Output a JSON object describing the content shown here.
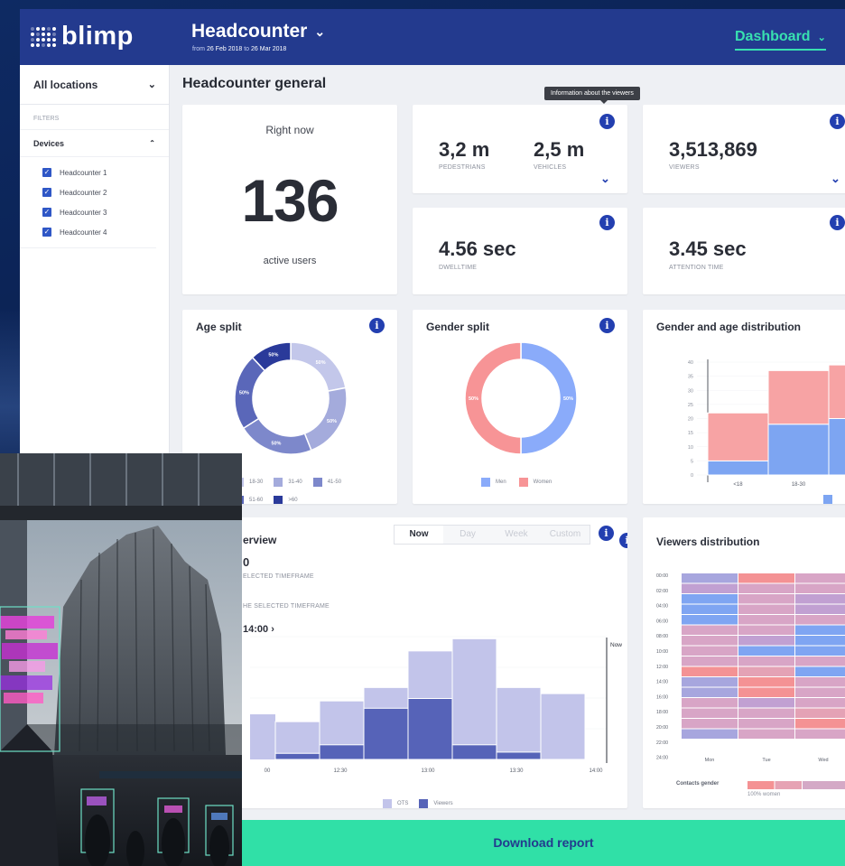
{
  "app": {
    "logo_text": "blimp",
    "title": "Headcounter",
    "date_from_label": "from",
    "date_from": "26 Feb 2018",
    "date_to_label": "to",
    "date_to": "26 Mar 2018",
    "nav_label": "Dashboard"
  },
  "sidebar": {
    "location": "All locations",
    "filters_label": "FILTERS",
    "devices_label": "Devices",
    "devices": [
      "Headcounter 1",
      "Headcounter 2",
      "Headcounter 3",
      "Headcounter 4"
    ]
  },
  "section_title": "Headcounter general",
  "tooltip": "Information about the viewers",
  "right_now": {
    "label": "Right now",
    "value": "136",
    "unit": "active users"
  },
  "kpis": {
    "pedestrians": {
      "value": "3,2 m",
      "label": "PEDESTRIANS"
    },
    "vehicles": {
      "value": "2,5 m",
      "label": "VEHICLES"
    },
    "viewers": {
      "value": "3,513,869",
      "label": "VIEWERS"
    },
    "dwelltime": {
      "value": "4.56 sec",
      "label": "DWELLTIME"
    },
    "attention": {
      "value": "3.45 sec",
      "label": "ATTENTION TIME"
    }
  },
  "age_split": {
    "title": "Age split",
    "slice_label": "50%",
    "legend": [
      "18-30",
      "31-40",
      "41-50",
      "51-60",
      ">60"
    ]
  },
  "gender_split": {
    "title": "Gender split",
    "slice_label": "50%",
    "legend": [
      "Men",
      "Women"
    ],
    "colors": {
      "men": "#8aabfa",
      "women": "#f79496"
    }
  },
  "gender_age": {
    "title": "Gender and age distribution",
    "yticks": [
      "40",
      "35",
      "30",
      "25",
      "20",
      "15",
      "10",
      "5",
      "0"
    ],
    "xticks": [
      "<18",
      "18-30",
      "31-"
    ]
  },
  "overview": {
    "title": "erview",
    "stat_value": "0",
    "stat_label_1": "ELECTED TIMEFRAME",
    "stat_label_2": "HE SELECTED TIMEFRAME",
    "time_link": "14:00",
    "tabs": [
      "Now",
      "Day",
      "Week",
      "Custom"
    ],
    "now_marker": "Now",
    "xticks": [
      "00",
      "12:30",
      "13:00",
      "13:30",
      "14:00"
    ],
    "legend": [
      "OTS",
      "Viewers"
    ]
  },
  "viewers_dist": {
    "title": "Viewers distribution",
    "hours": [
      "00:00",
      "02:00",
      "04:00",
      "06:00",
      "08:00",
      "10:00",
      "12:00",
      "14:00",
      "16:00",
      "18:00",
      "20:00",
      "22:00",
      "24:00"
    ],
    "days": [
      "Mon",
      "Tue",
      "Wed"
    ],
    "legend_label": "Contacts gender",
    "legend_sub": "100% women"
  },
  "download_label": "Download report",
  "chart_data": [
    {
      "type": "bar",
      "title": "Gender and age distribution",
      "categories": [
        "<18",
        "18-30",
        "31-"
      ],
      "ylim": [
        0,
        40
      ],
      "series": [
        {
          "name": "",
          "values": [
            5,
            18,
            20
          ]
        },
        {
          "name": "",
          "values": [
            17,
            19,
            19
          ]
        }
      ],
      "colors": [
        "#7da5f2",
        "#f7a3a4"
      ]
    },
    {
      "type": "bar",
      "categories": [
        "1",
        "2",
        "3",
        "4",
        "5",
        "6",
        "7",
        "8"
      ],
      "series": [
        {
          "name": "OTS",
          "values": [
            31,
            48,
            59,
            89,
            99,
            59,
            54,
            48
          ]
        },
        {
          "name": "Viewers",
          "values": [
            0,
            5,
            12,
            42,
            50,
            12,
            6,
            0
          ]
        }
      ],
      "legend": [
        "OTS",
        "Viewers"
      ],
      "colors": [
        "#c2c4ea",
        "#5663b8"
      ]
    },
    {
      "type": "pie",
      "title": "Gender split",
      "categories": [
        "Men",
        "Women"
      ],
      "values": [
        50,
        50
      ],
      "colors": [
        "#8aabfa",
        "#f79496"
      ]
    },
    {
      "type": "pie",
      "title": "Age split",
      "categories": [
        "18-30",
        "31-40",
        "41-50",
        "51-60",
        ">60"
      ],
      "values": [
        22,
        22,
        22,
        22,
        12
      ],
      "colors": [
        "#c3c7ea",
        "#a4abdc",
        "#7d88cb",
        "#5a67b9",
        "#2a3a9a"
      ]
    }
  ]
}
